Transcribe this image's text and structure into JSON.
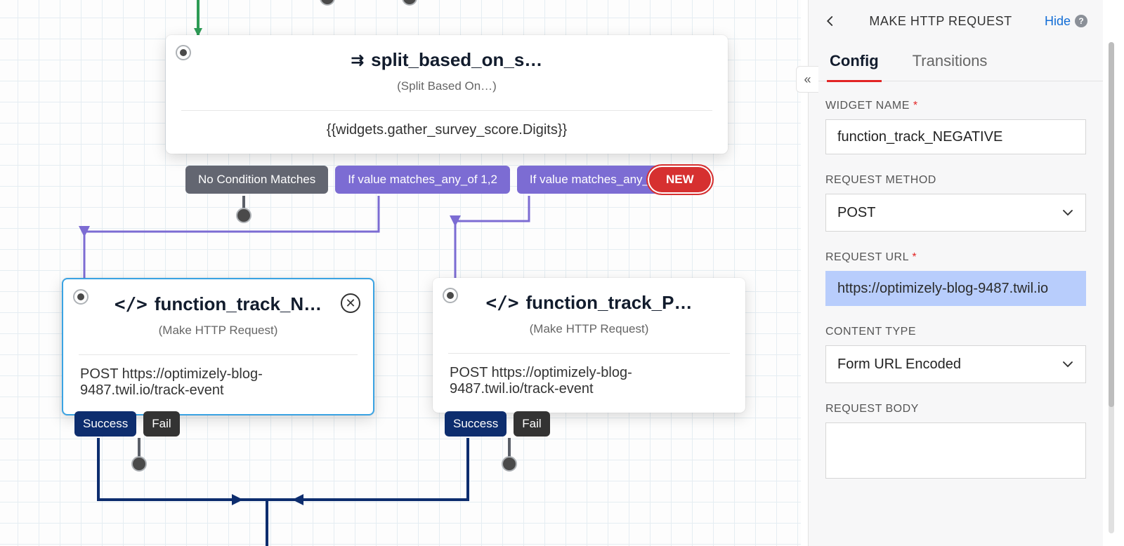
{
  "canvas": {
    "split_node": {
      "title": "split_based_on_s…",
      "subtitle": "(Split Based On…)",
      "body": "{{widgets.gather_survey_score.Digits}}",
      "chips": {
        "no_match": "No Condition Matches",
        "cond1": "If value matches_any_of 1,2",
        "cond2": "If value matches_any_of 3, 4, 5",
        "new": "NEW"
      }
    },
    "func_neg": {
      "title": "function_track_N…",
      "subtitle": "(Make HTTP Request)",
      "body": "POST https://optimizely-blog-9487.twil.io/track-event",
      "out": {
        "success": "Success",
        "fail": "Fail"
      }
    },
    "func_pos": {
      "title": "function_track_P…",
      "subtitle": "(Make HTTP Request)",
      "body": "POST https://optimizely-blog-9487.twil.io/track-event",
      "out": {
        "success": "Success",
        "fail": "Fail"
      }
    }
  },
  "panel": {
    "title": "MAKE HTTP REQUEST",
    "hide": "Hide",
    "tabs": {
      "config": "Config",
      "transitions": "Transitions"
    },
    "labels": {
      "widget_name": "WIDGET NAME",
      "request_method": "REQUEST METHOD",
      "request_url": "REQUEST URL",
      "content_type": "CONTENT TYPE",
      "request_body": "REQUEST BODY"
    },
    "values": {
      "widget_name": "function_track_NEGATIVE",
      "request_method": "POST",
      "request_url": "https://optimizely-blog-9487.twil.io",
      "content_type": "Form URL Encoded",
      "request_body": ""
    }
  }
}
